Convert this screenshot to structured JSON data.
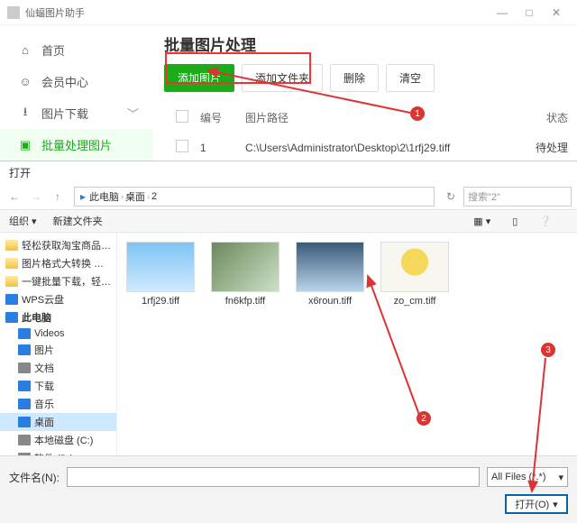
{
  "window": {
    "title": "仙蝠图片助手"
  },
  "sidebar": {
    "items": [
      {
        "label": "首页"
      },
      {
        "label": "会员中心"
      },
      {
        "label": "图片下载"
      },
      {
        "label": "批量处理图片"
      }
    ]
  },
  "page": {
    "title": "批量图片处理",
    "buttons": {
      "add_img": "添加图片",
      "add_folder": "添加文件夹",
      "delete": "删除",
      "clear": "清空"
    },
    "headers": {
      "num": "编号",
      "path": "图片路径",
      "status": "状态"
    },
    "rows": [
      {
        "num": "1",
        "path": "C:\\Users\\Administrator\\Desktop\\2\\1rfj29.tiff",
        "status": "待处理"
      }
    ]
  },
  "dialog": {
    "title": "打开",
    "breadcrumb": {
      "root": "此电脑",
      "p1": "桌面",
      "p2": "2"
    },
    "search_placeholder": "搜索\"2\"",
    "tools": {
      "org": "组织 ▾",
      "new_folder": "新建文件夹"
    },
    "tree": [
      {
        "label": "轻松获取淘宝商品…",
        "cls": "fld-yellow"
      },
      {
        "label": "图片格式大转换 …",
        "cls": "fld-yellow"
      },
      {
        "label": "一键批量下载，轻…",
        "cls": "fld-yellow"
      },
      {
        "label": "WPS云盘",
        "color": "#2a7de1"
      },
      {
        "label": "此电脑",
        "color": "#2a7de1",
        "bold": true
      },
      {
        "label": "Videos",
        "color": "#2a7de1",
        "indent": true
      },
      {
        "label": "图片",
        "color": "#2a7de1",
        "indent": true
      },
      {
        "label": "文档",
        "color": "#888",
        "indent": true
      },
      {
        "label": "下载",
        "color": "#2a7de1",
        "indent": true
      },
      {
        "label": "音乐",
        "color": "#2a7de1",
        "indent": true
      },
      {
        "label": "桌面",
        "color": "#2a7de1",
        "indent": true,
        "sel": true
      },
      {
        "label": "本地磁盘 (C:)",
        "color": "#888",
        "indent": true
      },
      {
        "label": "软件 (D:)",
        "color": "#888",
        "indent": true
      }
    ],
    "thumbs": [
      {
        "name": "1rfj29.tiff",
        "bg": "linear-gradient(180deg,#7ec4f5,#cfeaff)"
      },
      {
        "name": "fn6kfp.tiff",
        "bg": "linear-gradient(135deg,#6a8a5a,#cde0c8)"
      },
      {
        "name": "x6roun.tiff",
        "bg": "linear-gradient(180deg,#3a5a7a,#b8d4e8)"
      },
      {
        "name": "zo_cm.tiff",
        "bg": "radial-gradient(circle at 50% 40%, #f5d75a 30%, #f7f7f0 31%)"
      }
    ],
    "filename_label": "文件名(N):",
    "filter": "All Files (*.*)",
    "open": "打开(O)"
  }
}
